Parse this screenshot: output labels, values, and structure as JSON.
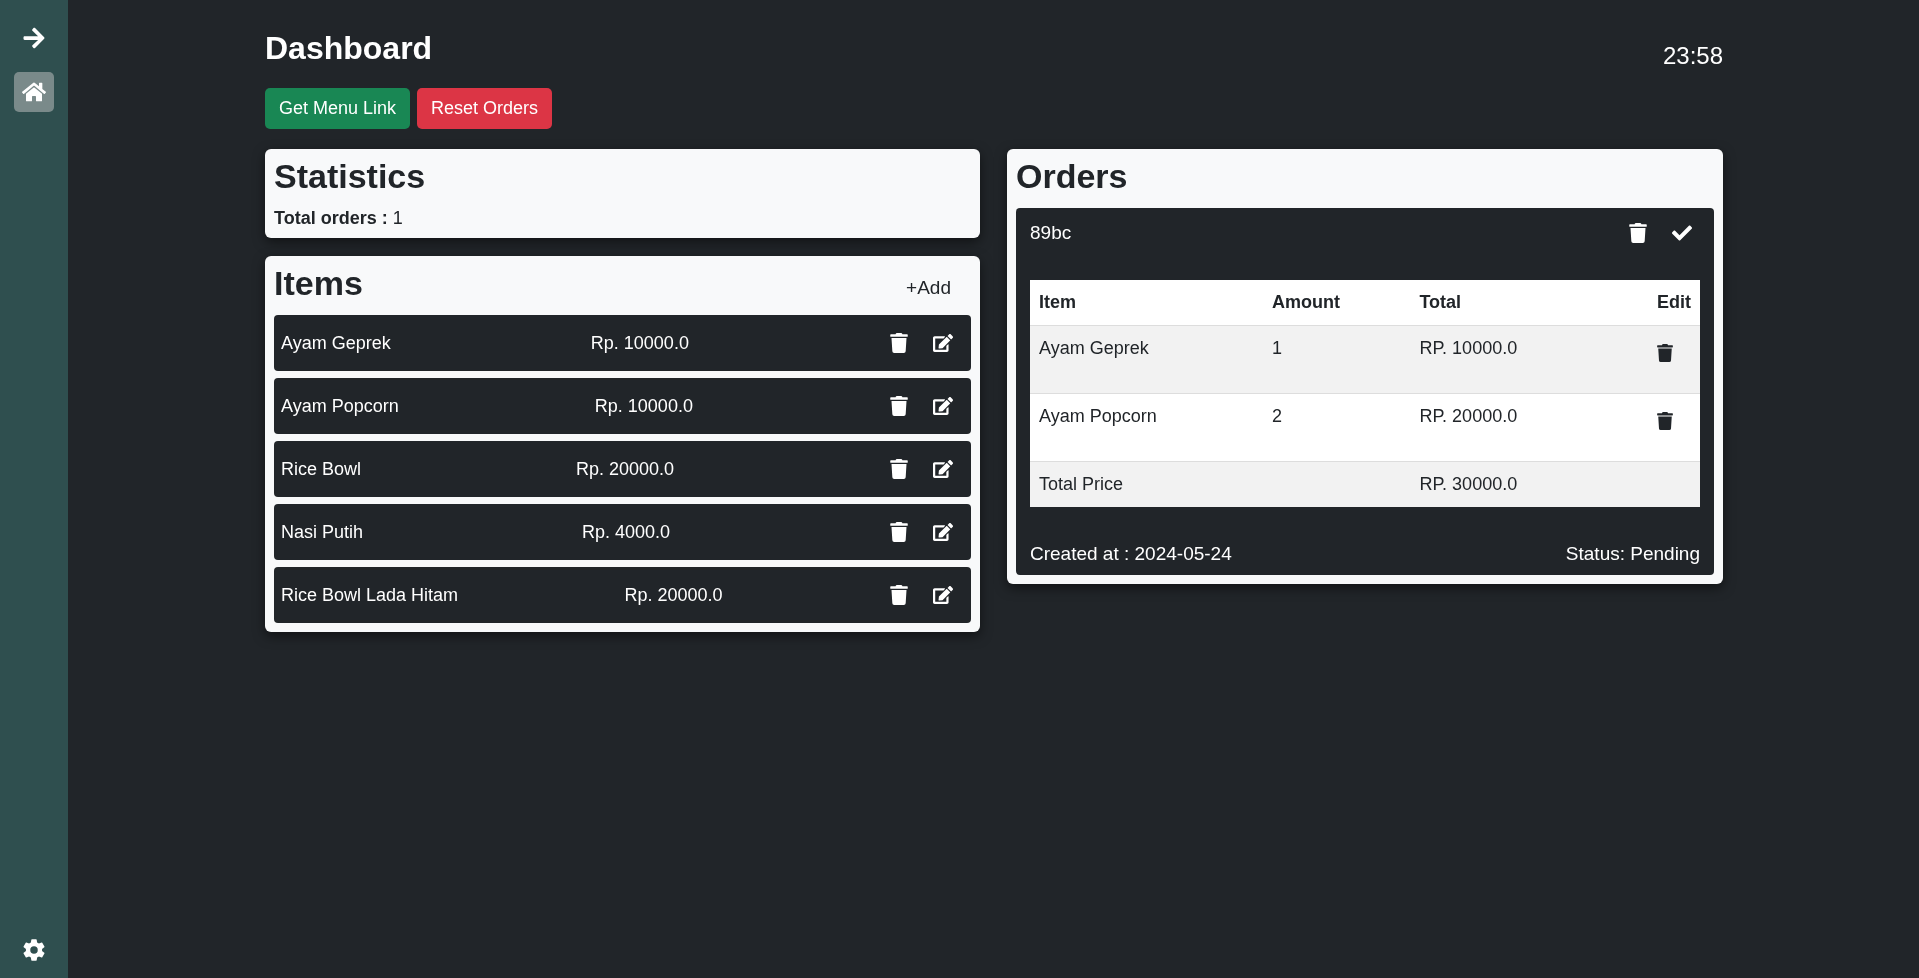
{
  "sidebar": {
    "items": [
      {
        "kind": "arrow",
        "selected": false
      },
      {
        "kind": "home",
        "selected": true
      }
    ],
    "footer": {
      "kind": "settings"
    }
  },
  "header": {
    "title": "Dashboard",
    "clock": "23:58",
    "buttons": [
      {
        "label": "Get Menu Link",
        "kind": "success"
      },
      {
        "label": "Reset Orders",
        "kind": "danger"
      }
    ]
  },
  "statistics": {
    "title": "Statistics",
    "label": "Total orders :",
    "value": "1"
  },
  "items": {
    "title": "Items",
    "add": "+Add",
    "rows": [
      {
        "name": "Ayam Geprek",
        "price": "Rp. 10000.0"
      },
      {
        "name": "Ayam Popcorn",
        "price": "Rp. 10000.0"
      },
      {
        "name": "Rice Bowl",
        "price": "Rp. 20000.0"
      },
      {
        "name": "Nasi Putih",
        "price": "Rp. 4000.0"
      },
      {
        "name": "Rice Bowl Lada Hitam",
        "price": "Rp. 20000.0"
      }
    ]
  },
  "orders": {
    "title": "Orders",
    "cards": [
      {
        "code": "89bc",
        "columns": [
          "Item",
          "Amount",
          "Total",
          "Edit"
        ],
        "rows": [
          {
            "item": "Ayam Geprek",
            "amount": "1",
            "total": "RP. 10000.0"
          },
          {
            "item": "Ayam Popcorn",
            "amount": "2",
            "total": "RP. 20000.0"
          }
        ],
        "total_label": "Total Price",
        "total": "RP. 30000.0",
        "created": "Created at : 2024-05-24",
        "status": "Status: Pending"
      }
    ]
  }
}
